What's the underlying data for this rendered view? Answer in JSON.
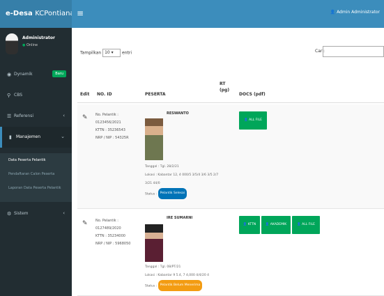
{
  "colors": {
    "header": "#3c8dbc",
    "sidebar": "#222d32",
    "success": "#00a65a",
    "status_primary": "#0073b7",
    "status_warning": "#f39c12"
  },
  "app": {
    "logo": "e-Desa ",
    "logo_suffix": "KCPontianak"
  },
  "topbar": {
    "toggle": "≡",
    "user": "Admin Administrator"
  },
  "sidebar": {
    "user_name": "Administrator",
    "user_status": "Online",
    "menu": [
      {
        "icon": "dashboard-icon",
        "label": "Dynamik",
        "badge": "Baru"
      },
      {
        "icon": "search-icon",
        "label": "CBS"
      },
      {
        "icon": "list-icon",
        "label": "Referensi"
      },
      {
        "icon": "book-icon",
        "label": "Manajemen"
      }
    ],
    "submenu": [
      "Data Peserta Pelantik",
      "Pendaftaran Calon Peserta",
      "Laporan Data Peserta Pelantik"
    ],
    "extra": {
      "icon": "gear-icon",
      "label": "Sistem"
    }
  },
  "toolbar": {
    "show_label": "Tampilkan",
    "show_value": "10",
    "entries_label": "entri",
    "search_label": "Cari:"
  },
  "table": {
    "headers": [
      "Edit",
      "NO. ID",
      "PESERTA",
      "RT\n(pg)",
      "DOCS (pdf)"
    ],
    "rows": [
      {
        "info": [
          "No. Pelantik :",
          "0123456/2021",
          "KTTN : 35236543",
          "NRP / NIP : 54325R"
        ],
        "name": "RESWANTO",
        "details": [
          "Tanggal : Tgl. 28/2/21",
          "Lokasi : Kabantar 12, 4 000/5 3/5/4 3/6 3/5 2/7",
          "3/21 44/0"
        ],
        "status_label": "Status :",
        "status": "Pelantik Selesai",
        "status_color": "#0073b7",
        "docs": [
          "ALL FILE"
        ]
      },
      {
        "info": [
          "No. Pelantik :",
          "0127489/2020",
          "KTTN : 35234000",
          "NRP / NIP : 5968050"
        ],
        "name": "IRE SUMARNI",
        "details": [
          "Tanggal : Tgl. 08/PT/21",
          "Lokasi : Kabantar 9 5.4, 7 4,000 4/4/20 4"
        ],
        "status_label": "Status :",
        "status": "Pelantik Belum Menerima",
        "status_color": "#f39c12",
        "docs": [
          "KTTN",
          "AKADEMIK",
          "ALL FILE"
        ]
      }
    ]
  }
}
